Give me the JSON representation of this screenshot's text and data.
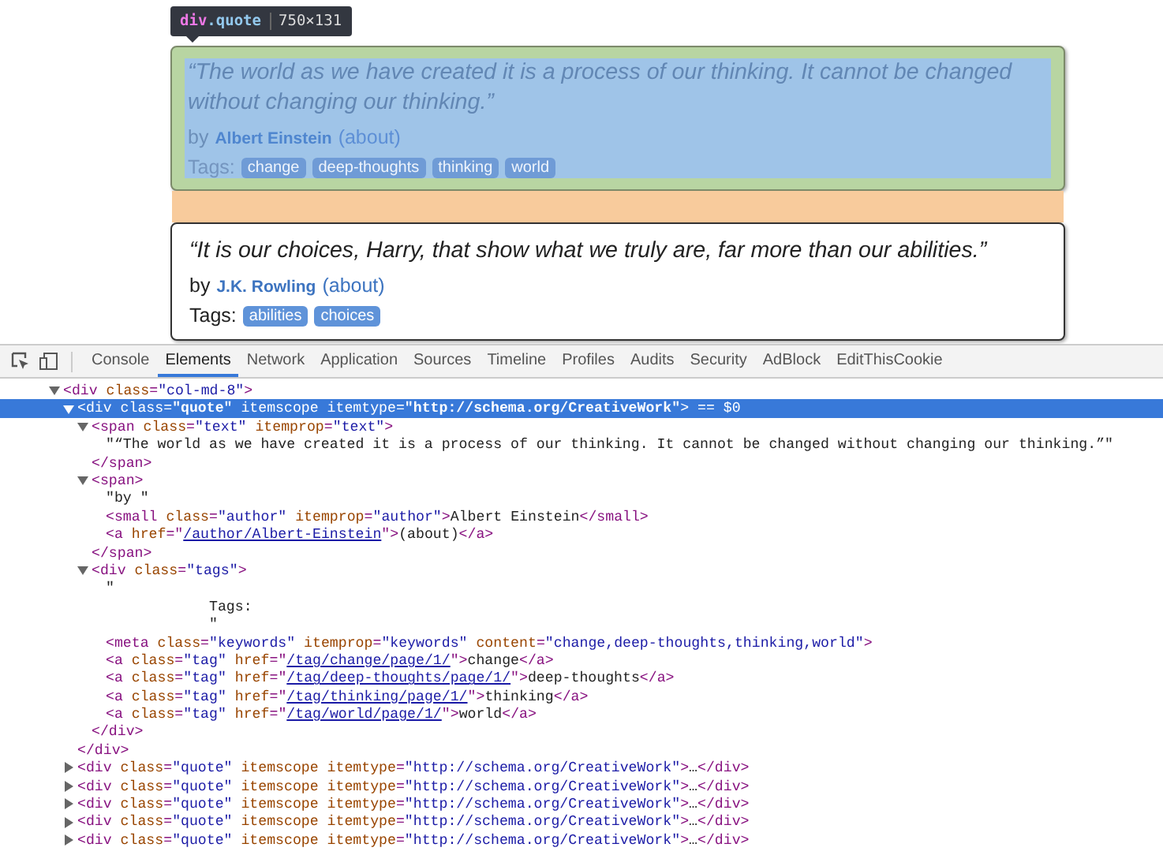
{
  "preview": {
    "tooltip": {
      "tag": "div",
      "cls": ".quote",
      "size": "750×131"
    },
    "quotes": [
      {
        "highlighted": true,
        "text": "“The world as we have created it is a process of our thinking. It cannot be changed without changing our thinking.”",
        "by": "by",
        "author": "Albert Einstein",
        "about": "(about)",
        "tags_label": "Tags:",
        "tags": [
          "change",
          "deep-thoughts",
          "thinking",
          "world"
        ]
      },
      {
        "highlighted": false,
        "text": "“It is our choices, Harry, that show what we truly are, far more than our abilities.”",
        "by": "by",
        "author": "J.K. Rowling",
        "about": "(about)",
        "tags_label": "Tags:",
        "tags": [
          "abilities",
          "choices"
        ]
      }
    ]
  },
  "devtools": {
    "tabs": [
      {
        "label": "Console",
        "selected": false
      },
      {
        "label": "Elements",
        "selected": true
      },
      {
        "label": "Network",
        "selected": false
      },
      {
        "label": "Application",
        "selected": false
      },
      {
        "label": "Sources",
        "selected": false
      },
      {
        "label": "Timeline",
        "selected": false
      },
      {
        "label": "Profiles",
        "selected": false
      },
      {
        "label": "Audits",
        "selected": false
      },
      {
        "label": "Security",
        "selected": false
      },
      {
        "label": "AdBlock",
        "selected": false
      },
      {
        "label": "EditThisCookie",
        "selected": false
      }
    ],
    "tree": [
      {
        "expanded": true,
        "selected": false,
        "open": [
          {
            "kind": "tag",
            "text": "<div"
          },
          {
            "kind": "attr",
            "text": " class"
          },
          {
            "kind": "tag",
            "text": "="
          },
          {
            "kind": "val",
            "text": "\"col-md-8\""
          },
          {
            "kind": "tag",
            "text": ">"
          }
        ],
        "children": [
          {
            "expanded": true,
            "selected": true,
            "open": [
              {
                "kind": "tag",
                "text": "<div"
              },
              {
                "kind": "attr",
                "text": " class"
              },
              {
                "kind": "tag",
                "text": "="
              },
              {
                "kind": "val",
                "text": "\"quote\""
              },
              {
                "kind": "attr",
                "text": " itemscope itemtype"
              },
              {
                "kind": "tag",
                "text": "="
              },
              {
                "kind": "val",
                "text": "\"http://schema.org/CreativeWork\""
              },
              {
                "kind": "tag",
                "text": ">"
              },
              {
                "kind": "dim",
                "text": " == $0"
              }
            ],
            "close": [
              {
                "kind": "tag",
                "text": "</div>"
              }
            ],
            "children": [
              {
                "expanded": true,
                "selected": false,
                "open": [
                  {
                    "kind": "tag",
                    "text": "<span"
                  },
                  {
                    "kind": "attr",
                    "text": " class"
                  },
                  {
                    "kind": "tag",
                    "text": "="
                  },
                  {
                    "kind": "val",
                    "text": "\"text\""
                  },
                  {
                    "kind": "attr",
                    "text": " itemprop"
                  },
                  {
                    "kind": "tag",
                    "text": "="
                  },
                  {
                    "kind": "val",
                    "text": "\"text\""
                  },
                  {
                    "kind": "tag",
                    "text": ">"
                  }
                ],
                "close": [
                  {
                    "kind": "tag",
                    "text": "</span>"
                  }
                ],
                "children": [
                  {
                    "selected": false,
                    "open": [
                      {
                        "kind": "text",
                        "text": "\"“The world as we have created it is a process of our thinking. It cannot be changed without changing our thinking.”\""
                      }
                    ]
                  }
                ]
              },
              {
                "expanded": true,
                "selected": false,
                "open": [
                  {
                    "kind": "tag",
                    "text": "<span>"
                  }
                ],
                "close": [
                  {
                    "kind": "tag",
                    "text": "</span>"
                  }
                ],
                "children": [
                  {
                    "selected": false,
                    "open": [
                      {
                        "kind": "text",
                        "text": "\"by \""
                      }
                    ]
                  },
                  {
                    "selected": false,
                    "open": [
                      {
                        "kind": "tag",
                        "text": "<small"
                      },
                      {
                        "kind": "attr",
                        "text": " class"
                      },
                      {
                        "kind": "tag",
                        "text": "="
                      },
                      {
                        "kind": "val",
                        "text": "\"author\""
                      },
                      {
                        "kind": "attr",
                        "text": " itemprop"
                      },
                      {
                        "kind": "tag",
                        "text": "="
                      },
                      {
                        "kind": "val",
                        "text": "\"author\""
                      },
                      {
                        "kind": "tag",
                        "text": ">"
                      },
                      {
                        "kind": "text",
                        "text": "Albert Einstein"
                      },
                      {
                        "kind": "tag",
                        "text": "</small>"
                      }
                    ]
                  },
                  {
                    "selected": false,
                    "open": [
                      {
                        "kind": "tag",
                        "text": "<a"
                      },
                      {
                        "kind": "attr",
                        "text": " href"
                      },
                      {
                        "kind": "tag",
                        "text": "=\""
                      },
                      {
                        "kind": "link",
                        "text": "/author/Albert-Einstein"
                      },
                      {
                        "kind": "tag",
                        "text": "\">"
                      },
                      {
                        "kind": "text",
                        "text": "(about)"
                      },
                      {
                        "kind": "tag",
                        "text": "</a>"
                      }
                    ]
                  }
                ]
              },
              {
                "expanded": true,
                "selected": false,
                "open": [
                  {
                    "kind": "tag",
                    "text": "<div"
                  },
                  {
                    "kind": "attr",
                    "text": " class"
                  },
                  {
                    "kind": "tag",
                    "text": "="
                  },
                  {
                    "kind": "val",
                    "text": "\"tags\""
                  },
                  {
                    "kind": "tag",
                    "text": ">"
                  }
                ],
                "close": [
                  {
                    "kind": "tag",
                    "text": "</div>"
                  }
                ],
                "children": [
                  {
                    "selected": false,
                    "open": [
                      {
                        "kind": "text",
                        "text": "\"\n            Tags:\n            \""
                      }
                    ]
                  },
                  {
                    "selected": false,
                    "open": [
                      {
                        "kind": "tag",
                        "text": "<meta"
                      },
                      {
                        "kind": "attr",
                        "text": " class"
                      },
                      {
                        "kind": "tag",
                        "text": "="
                      },
                      {
                        "kind": "val",
                        "text": "\"keywords\""
                      },
                      {
                        "kind": "attr",
                        "text": " itemprop"
                      },
                      {
                        "kind": "tag",
                        "text": "="
                      },
                      {
                        "kind": "val",
                        "text": "\"keywords\""
                      },
                      {
                        "kind": "attr",
                        "text": " content"
                      },
                      {
                        "kind": "tag",
                        "text": "="
                      },
                      {
                        "kind": "val",
                        "text": "\"change,deep-thoughts,thinking,world\""
                      },
                      {
                        "kind": "tag",
                        "text": ">"
                      }
                    ]
                  },
                  {
                    "selected": false,
                    "open": [
                      {
                        "kind": "tag",
                        "text": "<a"
                      },
                      {
                        "kind": "attr",
                        "text": " class"
                      },
                      {
                        "kind": "tag",
                        "text": "="
                      },
                      {
                        "kind": "val",
                        "text": "\"tag\""
                      },
                      {
                        "kind": "attr",
                        "text": " href"
                      },
                      {
                        "kind": "tag",
                        "text": "=\""
                      },
                      {
                        "kind": "link",
                        "text": "/tag/change/page/1/"
                      },
                      {
                        "kind": "tag",
                        "text": "\">"
                      },
                      {
                        "kind": "text",
                        "text": "change"
                      },
                      {
                        "kind": "tag",
                        "text": "</a>"
                      }
                    ]
                  },
                  {
                    "selected": false,
                    "open": [
                      {
                        "kind": "tag",
                        "text": "<a"
                      },
                      {
                        "kind": "attr",
                        "text": " class"
                      },
                      {
                        "kind": "tag",
                        "text": "="
                      },
                      {
                        "kind": "val",
                        "text": "\"tag\""
                      },
                      {
                        "kind": "attr",
                        "text": " href"
                      },
                      {
                        "kind": "tag",
                        "text": "=\""
                      },
                      {
                        "kind": "link",
                        "text": "/tag/deep-thoughts/page/1/"
                      },
                      {
                        "kind": "tag",
                        "text": "\">"
                      },
                      {
                        "kind": "text",
                        "text": "deep-thoughts"
                      },
                      {
                        "kind": "tag",
                        "text": "</a>"
                      }
                    ]
                  },
                  {
                    "selected": false,
                    "open": [
                      {
                        "kind": "tag",
                        "text": "<a"
                      },
                      {
                        "kind": "attr",
                        "text": " class"
                      },
                      {
                        "kind": "tag",
                        "text": "="
                      },
                      {
                        "kind": "val",
                        "text": "\"tag\""
                      },
                      {
                        "kind": "attr",
                        "text": " href"
                      },
                      {
                        "kind": "tag",
                        "text": "=\""
                      },
                      {
                        "kind": "link",
                        "text": "/tag/thinking/page/1/"
                      },
                      {
                        "kind": "tag",
                        "text": "\">"
                      },
                      {
                        "kind": "text",
                        "text": "thinking"
                      },
                      {
                        "kind": "tag",
                        "text": "</a>"
                      }
                    ]
                  },
                  {
                    "selected": false,
                    "open": [
                      {
                        "kind": "tag",
                        "text": "<a"
                      },
                      {
                        "kind": "attr",
                        "text": " class"
                      },
                      {
                        "kind": "tag",
                        "text": "="
                      },
                      {
                        "kind": "val",
                        "text": "\"tag\""
                      },
                      {
                        "kind": "attr",
                        "text": " href"
                      },
                      {
                        "kind": "tag",
                        "text": "=\""
                      },
                      {
                        "kind": "link",
                        "text": "/tag/world/page/1/"
                      },
                      {
                        "kind": "tag",
                        "text": "\">"
                      },
                      {
                        "kind": "text",
                        "text": "world"
                      },
                      {
                        "kind": "tag",
                        "text": "</a>"
                      }
                    ]
                  }
                ]
              }
            ]
          },
          {
            "expanded": false,
            "selected": false,
            "open": [
              {
                "kind": "tag",
                "text": "<div"
              },
              {
                "kind": "attr",
                "text": " class"
              },
              {
                "kind": "tag",
                "text": "="
              },
              {
                "kind": "val",
                "text": "\"quote\""
              },
              {
                "kind": "attr",
                "text": " itemscope itemtype"
              },
              {
                "kind": "tag",
                "text": "="
              },
              {
                "kind": "val",
                "text": "\"http://schema.org/CreativeWork\""
              },
              {
                "kind": "tag",
                "text": ">"
              },
              {
                "kind": "text",
                "text": "…"
              },
              {
                "kind": "tag",
                "text": "</div>"
              }
            ]
          },
          {
            "expanded": false,
            "selected": false,
            "open": [
              {
                "kind": "tag",
                "text": "<div"
              },
              {
                "kind": "attr",
                "text": " class"
              },
              {
                "kind": "tag",
                "text": "="
              },
              {
                "kind": "val",
                "text": "\"quote\""
              },
              {
                "kind": "attr",
                "text": " itemscope itemtype"
              },
              {
                "kind": "tag",
                "text": "="
              },
              {
                "kind": "val",
                "text": "\"http://schema.org/CreativeWork\""
              },
              {
                "kind": "tag",
                "text": ">"
              },
              {
                "kind": "text",
                "text": "…"
              },
              {
                "kind": "tag",
                "text": "</div>"
              }
            ]
          },
          {
            "expanded": false,
            "selected": false,
            "open": [
              {
                "kind": "tag",
                "text": "<div"
              },
              {
                "kind": "attr",
                "text": " class"
              },
              {
                "kind": "tag",
                "text": "="
              },
              {
                "kind": "val",
                "text": "\"quote\""
              },
              {
                "kind": "attr",
                "text": " itemscope itemtype"
              },
              {
                "kind": "tag",
                "text": "="
              },
              {
                "kind": "val",
                "text": "\"http://schema.org/CreativeWork\""
              },
              {
                "kind": "tag",
                "text": ">"
              },
              {
                "kind": "text",
                "text": "…"
              },
              {
                "kind": "tag",
                "text": "</div>"
              }
            ]
          },
          {
            "expanded": false,
            "selected": false,
            "open": [
              {
                "kind": "tag",
                "text": "<div"
              },
              {
                "kind": "attr",
                "text": " class"
              },
              {
                "kind": "tag",
                "text": "="
              },
              {
                "kind": "val",
                "text": "\"quote\""
              },
              {
                "kind": "attr",
                "text": " itemscope itemtype"
              },
              {
                "kind": "tag",
                "text": "="
              },
              {
                "kind": "val",
                "text": "\"http://schema.org/CreativeWork\""
              },
              {
                "kind": "tag",
                "text": ">"
              },
              {
                "kind": "text",
                "text": "…"
              },
              {
                "kind": "tag",
                "text": "</div>"
              }
            ]
          },
          {
            "expanded": false,
            "selected": false,
            "open": [
              {
                "kind": "tag",
                "text": "<div"
              },
              {
                "kind": "attr",
                "text": " class"
              },
              {
                "kind": "tag",
                "text": "="
              },
              {
                "kind": "val",
                "text": "\"quote\""
              },
              {
                "kind": "attr",
                "text": " itemscope itemtype"
              },
              {
                "kind": "tag",
                "text": "="
              },
              {
                "kind": "val",
                "text": "\"http://schema.org/CreativeWork\""
              },
              {
                "kind": "tag",
                "text": ">"
              },
              {
                "kind": "text",
                "text": "…"
              },
              {
                "kind": "tag",
                "text": "</div>"
              }
            ]
          }
        ]
      }
    ]
  }
}
